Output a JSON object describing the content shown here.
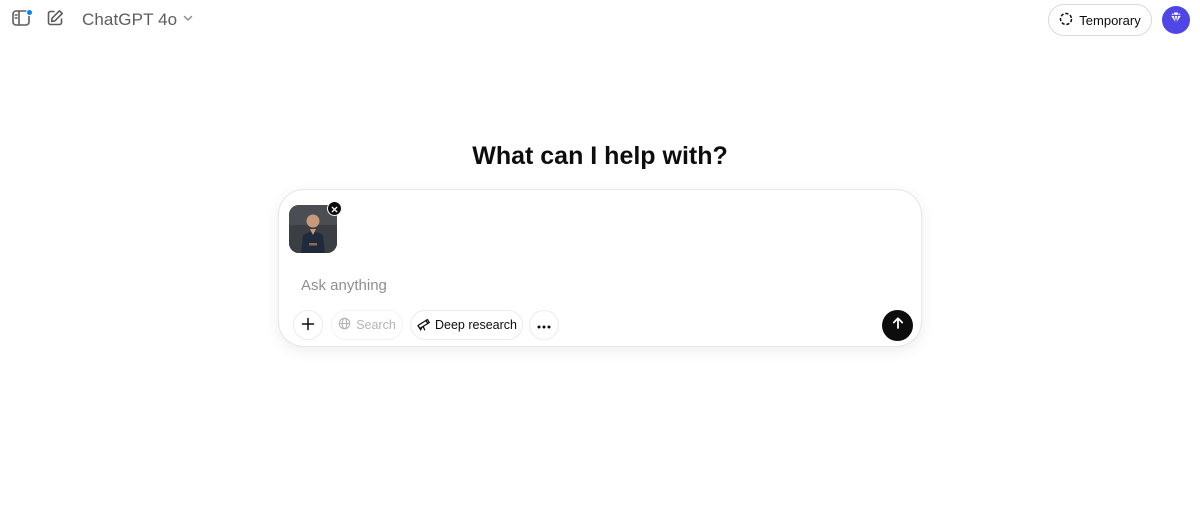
{
  "header": {
    "model_name": "ChatGPT 4o",
    "temporary_label": "Temporary"
  },
  "main": {
    "headline": "What can I help with?"
  },
  "composer": {
    "placeholder": "Ask anything",
    "value": "",
    "tools": {
      "search_label": "Search",
      "deep_research_label": "Deep research"
    }
  },
  "icons": {
    "sidebar": "sidebar-toggle-icon",
    "new_chat": "compose-icon",
    "model_dropdown": "chevron-down-icon",
    "temporary": "dashed-circle-icon",
    "attach": "plus-icon",
    "search": "globe-icon",
    "deep_research": "telescope-icon",
    "more": "ellipsis-icon",
    "send": "arrow-up-icon",
    "remove_attachment": "close-icon"
  },
  "colors": {
    "accent_dot": "#0285ff",
    "avatar_bg": "#4f46e5",
    "send_bg": "#0d0d0d"
  }
}
